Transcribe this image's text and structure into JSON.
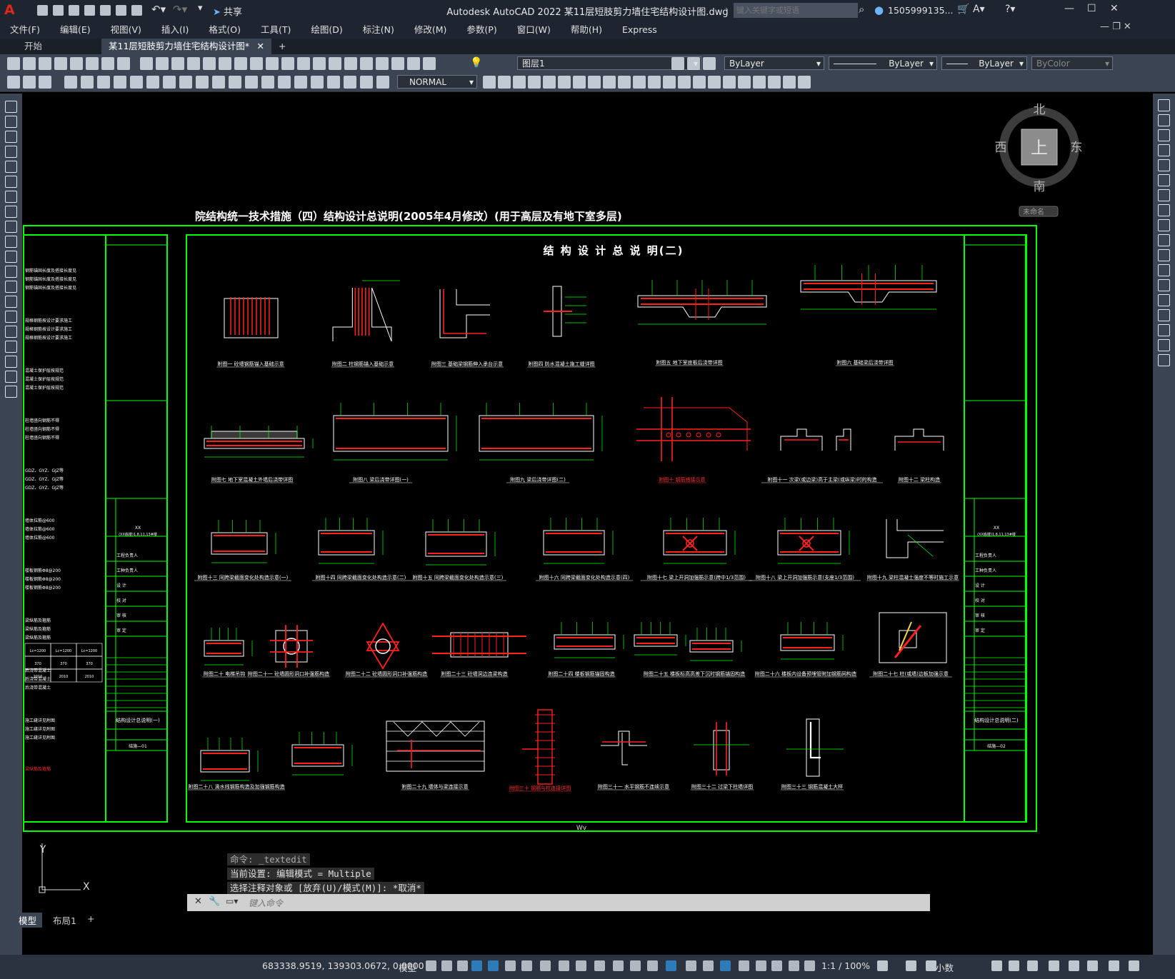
{
  "titlebar": {
    "app_letter": "A",
    "share": "共享",
    "title": "Autodesk AutoCAD 2022    某11层短肢剪力墙住宅结构设计图.dwg",
    "search_placeholder": "键入关键字或短语",
    "user": "1505999135...",
    "win_controls": [
      "—",
      "☐",
      "✕"
    ]
  },
  "menu": [
    "文件(F)",
    "编辑(E)",
    "视图(V)",
    "插入(I)",
    "格式(O)",
    "工具(T)",
    "绘图(D)",
    "标注(N)",
    "修改(M)",
    "参数(P)",
    "窗口(W)",
    "帮助(H)",
    "Express"
  ],
  "tabs": {
    "start": "开始",
    "active": "某11层短肢剪力墙住宅结构设计图*",
    "add": "+"
  },
  "toolbar": {
    "layer": "图层1",
    "color": "ByLayer",
    "linetype": "ByLayer",
    "lineweight": "ByLayer",
    "plotstyle": "ByColor",
    "textstyle": "NORMAL"
  },
  "viewcube": {
    "north": "北",
    "south": "南",
    "east": "东",
    "west": "西",
    "top": "上",
    "wcs": "未命名"
  },
  "drawing": {
    "header": "院结构统一技术措施（四）结构设计总说明(2005年4月修改）(用于高层及有地下室多层)",
    "sheet_title": "结 构 设 计 总 说 明(二)",
    "wv": "Wv",
    "captions_row1": [
      "附图一 砼墙钢筋锚入基础示意",
      "附图二 柱钢筋锚入基础示意",
      "附图三 基础梁钢筋伸入承台示意",
      "附图四 防水混凝土施工缝详图",
      "附图五 地下室底板后浇带详图",
      "附图六 基础梁后浇带详图"
    ],
    "captions_row2": [
      "附图七 地下室混凝土外墙后浇带详图",
      "附图八 梁后浇带详图(一)",
      "附图九 梁后浇带详图(二)",
      "附图十 钢筋搭接示意",
      "附图十一 次梁(或边梁)高于主梁(或纵梁)时的构造",
      "附图十二 梁柱构造"
    ],
    "captions_row3": [
      "附图十三 同跨梁截面变化处构造示意(一)",
      "附图十四 同跨梁截面变化处构造示意(二)",
      "附图十五 同跨梁截面变化处构造示意(三)",
      "附图十六 同跨梁截面变化处构造示意(四)",
      "附图十七 梁上开洞加强筋示意(跨中1/3范围)",
      "附图十八 梁上开洞加强筋示意(支座1/3范围)",
      "附图十九 梁柱混凝土强度不等时施工示意"
    ],
    "captions_row4": [
      "附图二十 电梯吊钩",
      "附图二十一 砼墙圆形洞口补强筋构造",
      "附图二十二 砼墙圆形洞口补强筋构造",
      "附图二十三 砼墙洞边连梁构造",
      "附图二十四 楼板钢筋锚固构造",
      "附图二十五 楼板标高高差下沉时钢筋锚固构造",
      "附图二十六 楼板内设备预埋管附加钢筋网构造",
      "附图二十七 柱(或墙)边板加强示意"
    ],
    "captions_row5": [
      "附图二十八 滴水线钢筋构造及加强钢筋构造",
      "附图二十九 墙体与梁连接示意",
      "附图三十 钢筋与柱连接详图",
      "附图三十一 水平钢筋不连续示意",
      "附图三十二 过梁下柱墙详图",
      "附图三十三 钢筋混凝土大样"
    ],
    "left_block_title": "结构设计总说明(一)",
    "right_block_title": "结构设计总说明(二)",
    "block_project": "XX",
    "block_sub": "(XX栋楼)1,8,11,13#楼",
    "block_rows": [
      "工程负责人",
      "工种负责人",
      "设 计",
      "校 对",
      "审 核",
      "审 定"
    ],
    "block_no_left": "结施—01",
    "block_no_right": "结施—02",
    "left_notes": [
      "钢筋锚固长度及搭接长度见",
      "规格钢筋按设计要求施工",
      "混凝土保护层按规范",
      "柱墙竖向钢筋不得",
      "GDZ、GYZ、GJZ等",
      "墙体拉筋@600",
      "楼板钢筋Φ8@200",
      "梁纵筋及箍筋",
      "后浇带混凝土",
      "施工缝详见附图"
    ],
    "left_table": [
      [
        "Lc=1200",
        "Lc=1200",
        "Lc=1200"
      ],
      [
        "370",
        "370",
        "370"
      ],
      [
        "2010",
        "2010",
        "2010"
      ]
    ]
  },
  "command": {
    "history": [
      "命令: _textedit",
      "当前设置: 编辑模式 = Multiple",
      "选择注释对象或 [放弃(U)/模式(M)]: *取消*"
    ],
    "placeholder": "键入命令"
  },
  "ucs": {
    "y": "Y",
    "x": "X"
  },
  "layout_tabs": [
    "模型",
    "布局1",
    "+"
  ],
  "status": {
    "coords": "683338.9519, 139303.0672, 0.0000",
    "mode": "模型",
    "scale": "1:1 / 100%",
    "units": "小数"
  },
  "colors": {
    "accent_green": "#00ff00",
    "chrome": "#3b4453",
    "title": "#1e2430"
  }
}
